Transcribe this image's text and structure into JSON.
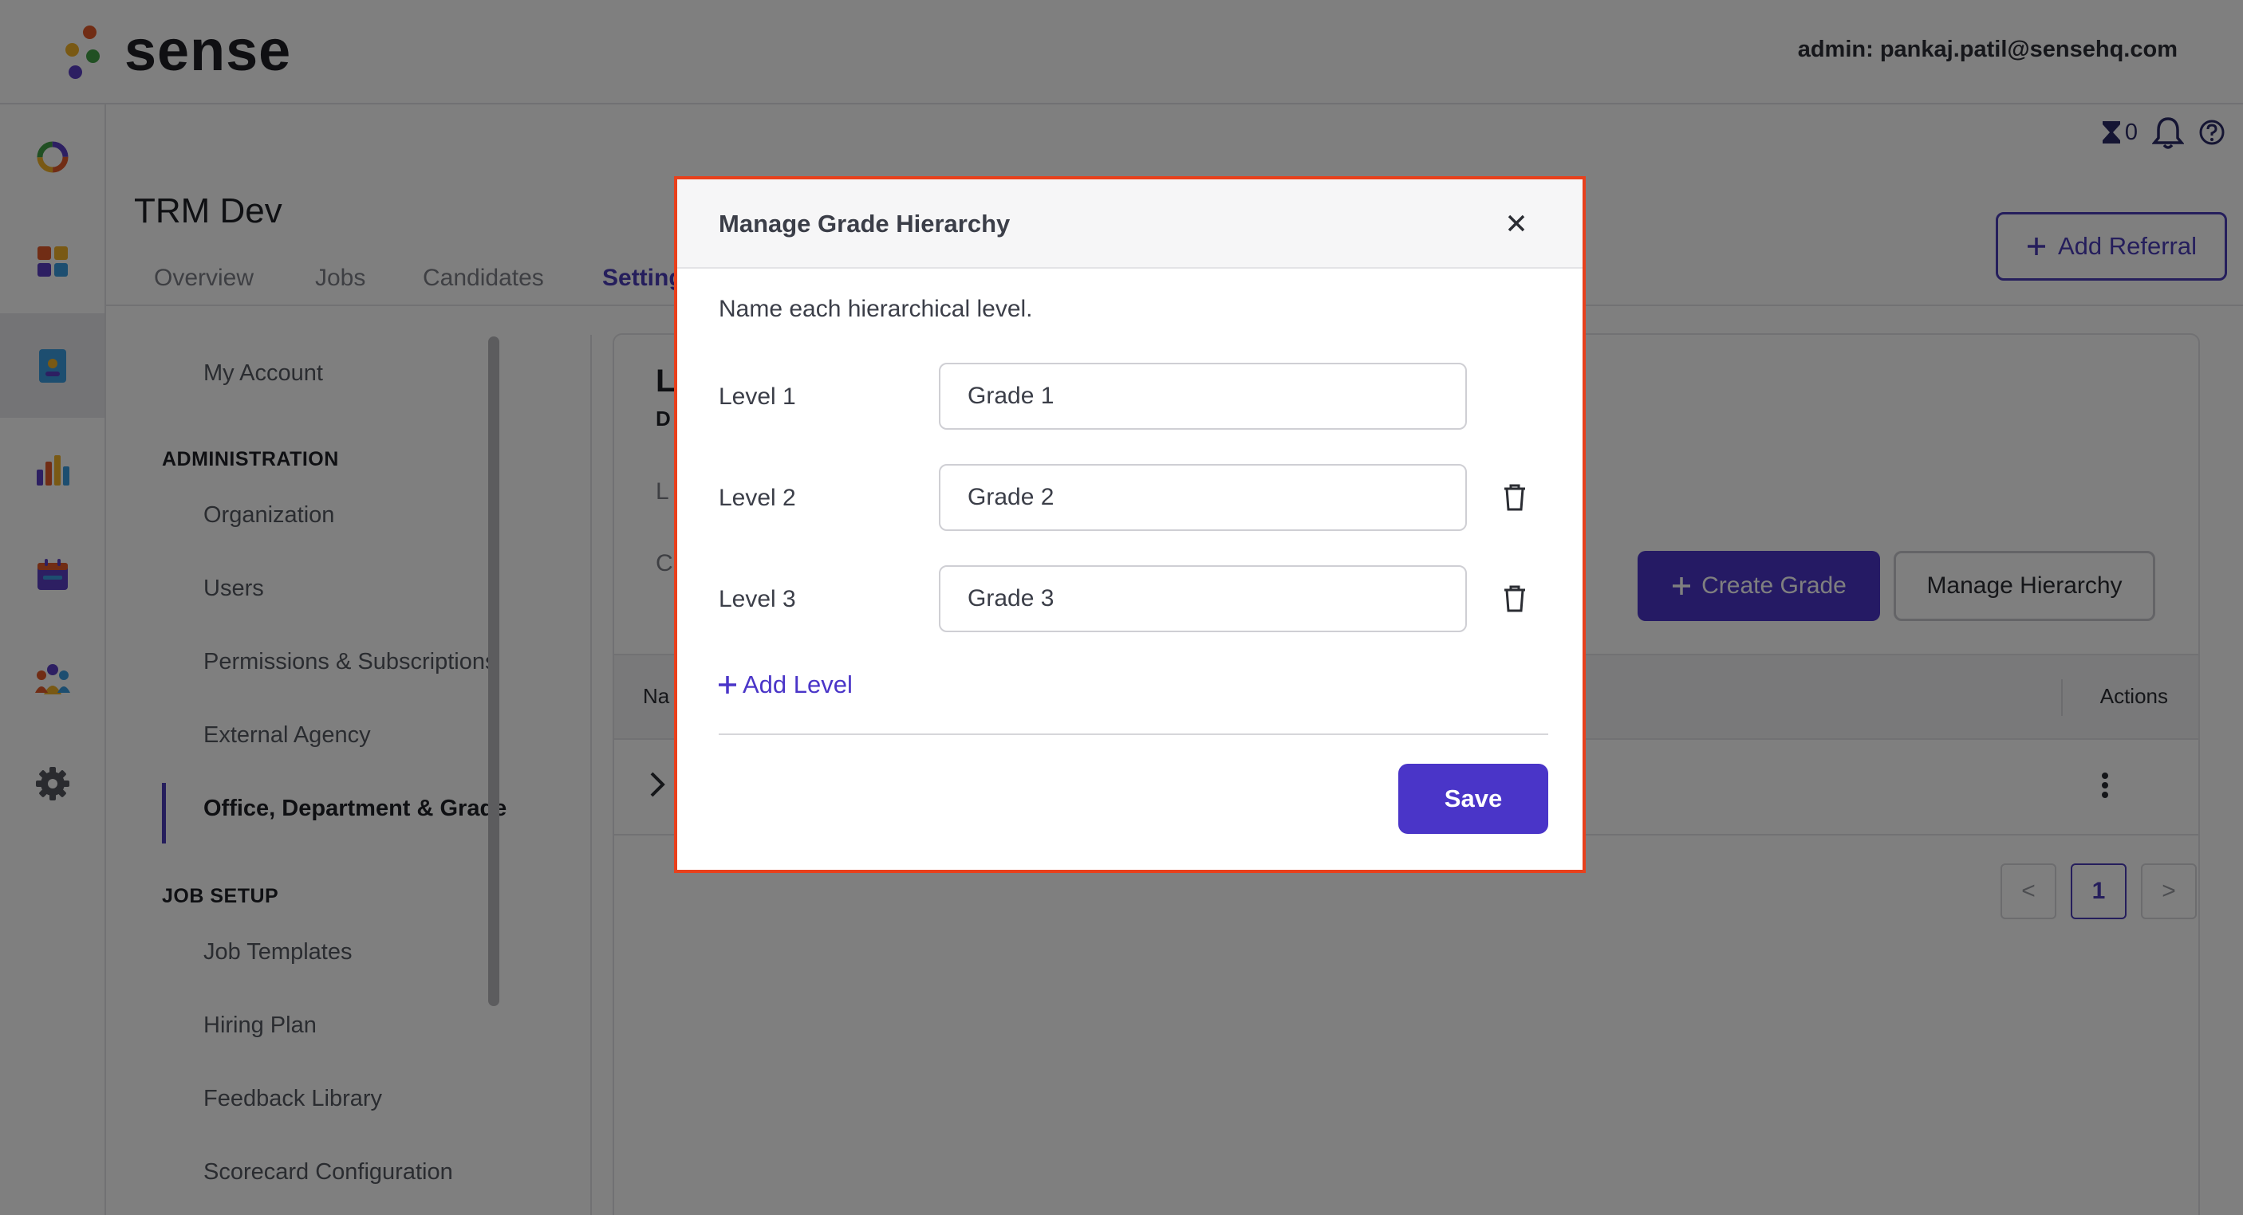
{
  "header": {
    "logo_text": "sense",
    "admin_label": "admin: pankaj.patil@sensehq.com"
  },
  "utility": {
    "hourglass_count": "0",
    "icons": [
      "hourglass-icon",
      "bell-icon",
      "help-icon"
    ]
  },
  "rail": {
    "icons": [
      "ring-logo-icon",
      "dashboard-grid-icon",
      "document-icon",
      "bar-chart-icon",
      "calendar-icon",
      "team-icon",
      "gear-icon"
    ],
    "active_index": 2
  },
  "page": {
    "title": "TRM Dev",
    "tabs": [
      {
        "label": "Overview"
      },
      {
        "label": "Jobs"
      },
      {
        "label": "Candidates"
      },
      {
        "label": "Setting"
      }
    ],
    "add_referral_label": "Add Referral"
  },
  "subnav": {
    "my_account": "My Account",
    "admin_heading": "ADMINISTRATION",
    "admin_items": [
      {
        "label": "Organization"
      },
      {
        "label": "Users"
      },
      {
        "label": "Permissions & Subscriptions"
      },
      {
        "label": "External Agency"
      },
      {
        "label": "Office, Department & Grade"
      }
    ],
    "job_setup_heading": "JOB SETUP",
    "job_items": [
      {
        "label": "Job Templates"
      },
      {
        "label": "Hiring Plan"
      },
      {
        "label": "Feedback Library"
      },
      {
        "label": "Scorecard Configuration"
      }
    ]
  },
  "main": {
    "frag_title": "L",
    "frag_sub": "D",
    "frag_l": "L",
    "frag_c": "C",
    "create_grade_label": "Create Grade",
    "manage_hierarchy_label": "Manage Hierarchy",
    "table_head_name": "Na",
    "table_head_actions": "Actions",
    "pager": {
      "prev": "<",
      "current": "1",
      "next": ">"
    }
  },
  "modal": {
    "title": "Manage Grade Hierarchy",
    "description": "Name each hierarchical level.",
    "levels": [
      {
        "label": "Level 1",
        "value": "Grade 1"
      },
      {
        "label": "Level 2",
        "value": "Grade 2"
      },
      {
        "label": "Level 3",
        "value": "Grade 3"
      }
    ],
    "add_level_label": "Add Level",
    "save_label": "Save"
  },
  "colors": {
    "brand_purple": "#4a35c8",
    "modal_outline": "#e8401c",
    "logo_dots": [
      "#e25b2a",
      "#f2b229",
      "#43a047",
      "#5b3fc4"
    ]
  }
}
